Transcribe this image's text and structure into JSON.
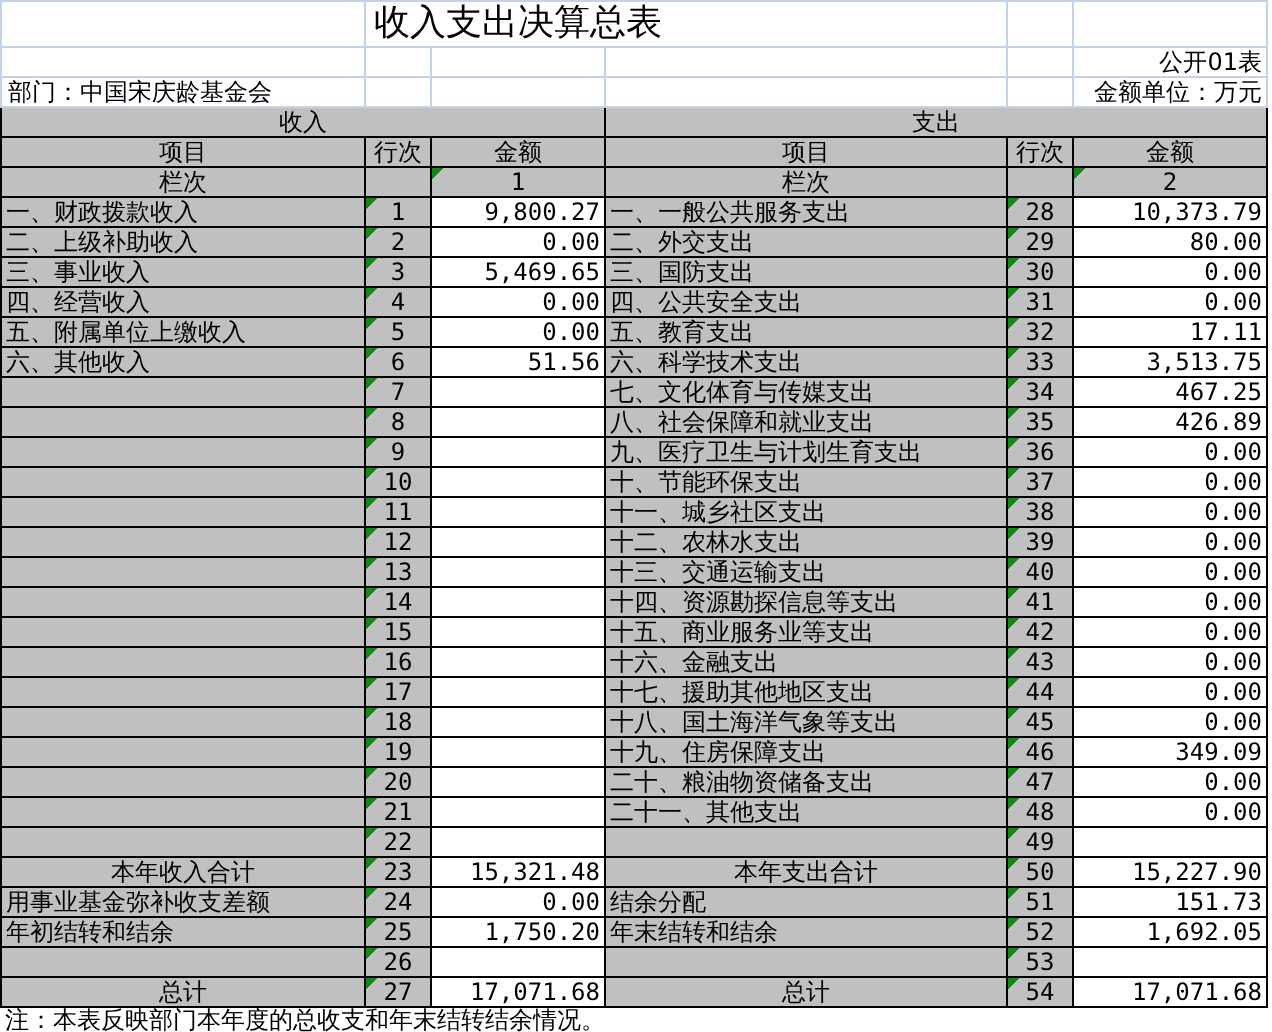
{
  "title": "收入支出决算总表",
  "form_no": "公开01表",
  "department": "部门：中国宋庆龄基金会",
  "unit": "金额单位：万元",
  "sides": [
    {
      "header": "收入",
      "columns": [
        "项目",
        "行次",
        "金额"
      ],
      "index_label": "栏次",
      "index_value": "1"
    },
    {
      "header": "支出",
      "columns": [
        "项目",
        "行次",
        "金额"
      ],
      "index_label": "栏次",
      "index_value": "2"
    }
  ],
  "rows": [
    {
      "income": {
        "kind": "item",
        "label": "一、财政拨款收入",
        "line": "1",
        "amount": "9,800.27"
      },
      "expense": {
        "kind": "item",
        "label": "一、一般公共服务支出",
        "line": "28",
        "amount": "10,373.79"
      }
    },
    {
      "income": {
        "kind": "item",
        "label": "二、上级补助收入",
        "line": "2",
        "amount": "0.00"
      },
      "expense": {
        "kind": "item",
        "label": "二、外交支出",
        "line": "29",
        "amount": "80.00"
      }
    },
    {
      "income": {
        "kind": "item",
        "label": "三、事业收入",
        "line": "3",
        "amount": "5,469.65"
      },
      "expense": {
        "kind": "item",
        "label": "三、国防支出",
        "line": "30",
        "amount": "0.00"
      }
    },
    {
      "income": {
        "kind": "item",
        "label": "四、经营收入",
        "line": "4",
        "amount": "0.00"
      },
      "expense": {
        "kind": "item",
        "label": "四、公共安全支出",
        "line": "31",
        "amount": "0.00"
      }
    },
    {
      "income": {
        "kind": "item",
        "label": "五、附属单位上缴收入",
        "line": "5",
        "amount": "0.00"
      },
      "expense": {
        "kind": "item",
        "label": "五、教育支出",
        "line": "32",
        "amount": "17.11"
      }
    },
    {
      "income": {
        "kind": "item",
        "label": "六、其他收入",
        "line": "6",
        "amount": "51.56"
      },
      "expense": {
        "kind": "item",
        "label": "六、科学技术支出",
        "line": "33",
        "amount": "3,513.75"
      }
    },
    {
      "income": {
        "kind": "item",
        "line": "7"
      },
      "expense": {
        "kind": "item",
        "label": "七、文化体育与传媒支出",
        "line": "34",
        "amount": "467.25"
      }
    },
    {
      "income": {
        "kind": "item",
        "line": "8"
      },
      "expense": {
        "kind": "item",
        "label": "八、社会保障和就业支出",
        "line": "35",
        "amount": "426.89"
      }
    },
    {
      "income": {
        "kind": "item",
        "line": "9"
      },
      "expense": {
        "kind": "item",
        "label": "九、医疗卫生与计划生育支出",
        "line": "36",
        "amount": "0.00"
      }
    },
    {
      "income": {
        "kind": "item",
        "line": "10"
      },
      "expense": {
        "kind": "item",
        "label": "十、节能环保支出",
        "line": "37",
        "amount": "0.00"
      }
    },
    {
      "income": {
        "kind": "item",
        "line": "11"
      },
      "expense": {
        "kind": "item",
        "label": "十一、城乡社区支出",
        "line": "38",
        "amount": "0.00"
      }
    },
    {
      "income": {
        "kind": "item",
        "line": "12"
      },
      "expense": {
        "kind": "item",
        "label": "十二、农林水支出",
        "line": "39",
        "amount": "0.00"
      }
    },
    {
      "income": {
        "kind": "item",
        "line": "13"
      },
      "expense": {
        "kind": "item",
        "label": "十三、交通运输支出",
        "line": "40",
        "amount": "0.00"
      }
    },
    {
      "income": {
        "kind": "item",
        "line": "14"
      },
      "expense": {
        "kind": "item",
        "label": "十四、资源勘探信息等支出",
        "line": "41",
        "amount": "0.00"
      }
    },
    {
      "income": {
        "kind": "item",
        "line": "15"
      },
      "expense": {
        "kind": "item",
        "label": "十五、商业服务业等支出",
        "line": "42",
        "amount": "0.00"
      }
    },
    {
      "income": {
        "kind": "item",
        "line": "16"
      },
      "expense": {
        "kind": "item",
        "label": "十六、金融支出",
        "line": "43",
        "amount": "0.00"
      }
    },
    {
      "income": {
        "kind": "item",
        "line": "17"
      },
      "expense": {
        "kind": "item",
        "label": "十七、援助其他地区支出",
        "line": "44",
        "amount": "0.00"
      }
    },
    {
      "income": {
        "kind": "item",
        "line": "18"
      },
      "expense": {
        "kind": "item",
        "label": "十八、国土海洋气象等支出",
        "line": "45",
        "amount": "0.00"
      }
    },
    {
      "income": {
        "kind": "item",
        "line": "19"
      },
      "expense": {
        "kind": "item",
        "label": "十九、住房保障支出",
        "line": "46",
        "amount": "349.09"
      }
    },
    {
      "income": {
        "kind": "item",
        "line": "20"
      },
      "expense": {
        "kind": "item",
        "label": "二十、粮油物资储备支出",
        "line": "47",
        "amount": "0.00"
      }
    },
    {
      "income": {
        "kind": "item",
        "line": "21"
      },
      "expense": {
        "kind": "item",
        "label": "二十一、其他支出",
        "line": "48",
        "amount": "0.00"
      }
    },
    {
      "income": {
        "kind": "item",
        "line": "22"
      },
      "expense": {
        "kind": "item",
        "line": "49"
      }
    },
    {
      "income": {
        "kind": "total",
        "label": "本年收入合计",
        "line": "23",
        "amount": "15,321.48"
      },
      "expense": {
        "kind": "total",
        "label": "本年支出合计",
        "line": "50",
        "amount": "15,227.90"
      }
    },
    {
      "income": {
        "kind": "item",
        "label": "用事业基金弥补收支差额",
        "line": "24",
        "amount": "0.00"
      },
      "expense": {
        "kind": "item",
        "label": "结余分配",
        "line": "51",
        "amount": "151.73"
      }
    },
    {
      "income": {
        "kind": "item",
        "label": "年初结转和结余",
        "line": "25",
        "amount": "1,750.20"
      },
      "expense": {
        "kind": "item",
        "label": "年末结转和结余",
        "line": "52",
        "amount": "1,692.05"
      }
    },
    {
      "income": {
        "kind": "item",
        "line": "26"
      },
      "expense": {
        "kind": "item",
        "line": "53"
      }
    },
    {
      "income": {
        "kind": "total",
        "label": "总计",
        "line": "27",
        "amount": "17,071.68"
      },
      "expense": {
        "kind": "total",
        "label": "总计",
        "line": "54",
        "amount": "17,071.68"
      }
    }
  ],
  "note": "注：本表反映部门本年度的总收支和年末结转结余情况。"
}
